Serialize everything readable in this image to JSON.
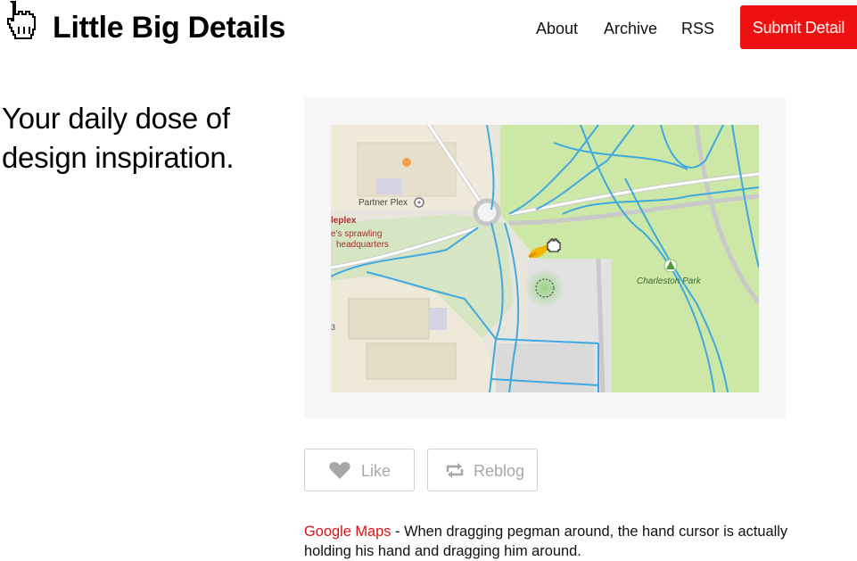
{
  "header": {
    "site_title": "Little Big Details",
    "nav": {
      "about": "About",
      "archive": "Archive",
      "rss": "RSS"
    },
    "submit_label": "Submit Detail"
  },
  "tagline": "Your daily dose of design inspiration.",
  "post": {
    "map_labels": {
      "partner_plex": "Partner Plex",
      "charleston_park": "Charleston Park",
      "googleplex_partial": "leplex",
      "sprawling_partial": "e's sprawling",
      "hq_partial": "headquarters",
      "edge_partial": "3"
    },
    "like_label": "Like",
    "reblog_label": "Reblog",
    "caption": {
      "link_text": "Google Maps",
      "text": " - When dragging pegman around, the hand cursor is actually holding his hand and dragging him around."
    }
  },
  "colors": {
    "accent": "#ee1111",
    "link": "#dd1111",
    "map_park": "#cde8a6",
    "map_building": "#efe9da",
    "map_water_path": "#3fa9e0",
    "map_road": "#ffffff"
  }
}
